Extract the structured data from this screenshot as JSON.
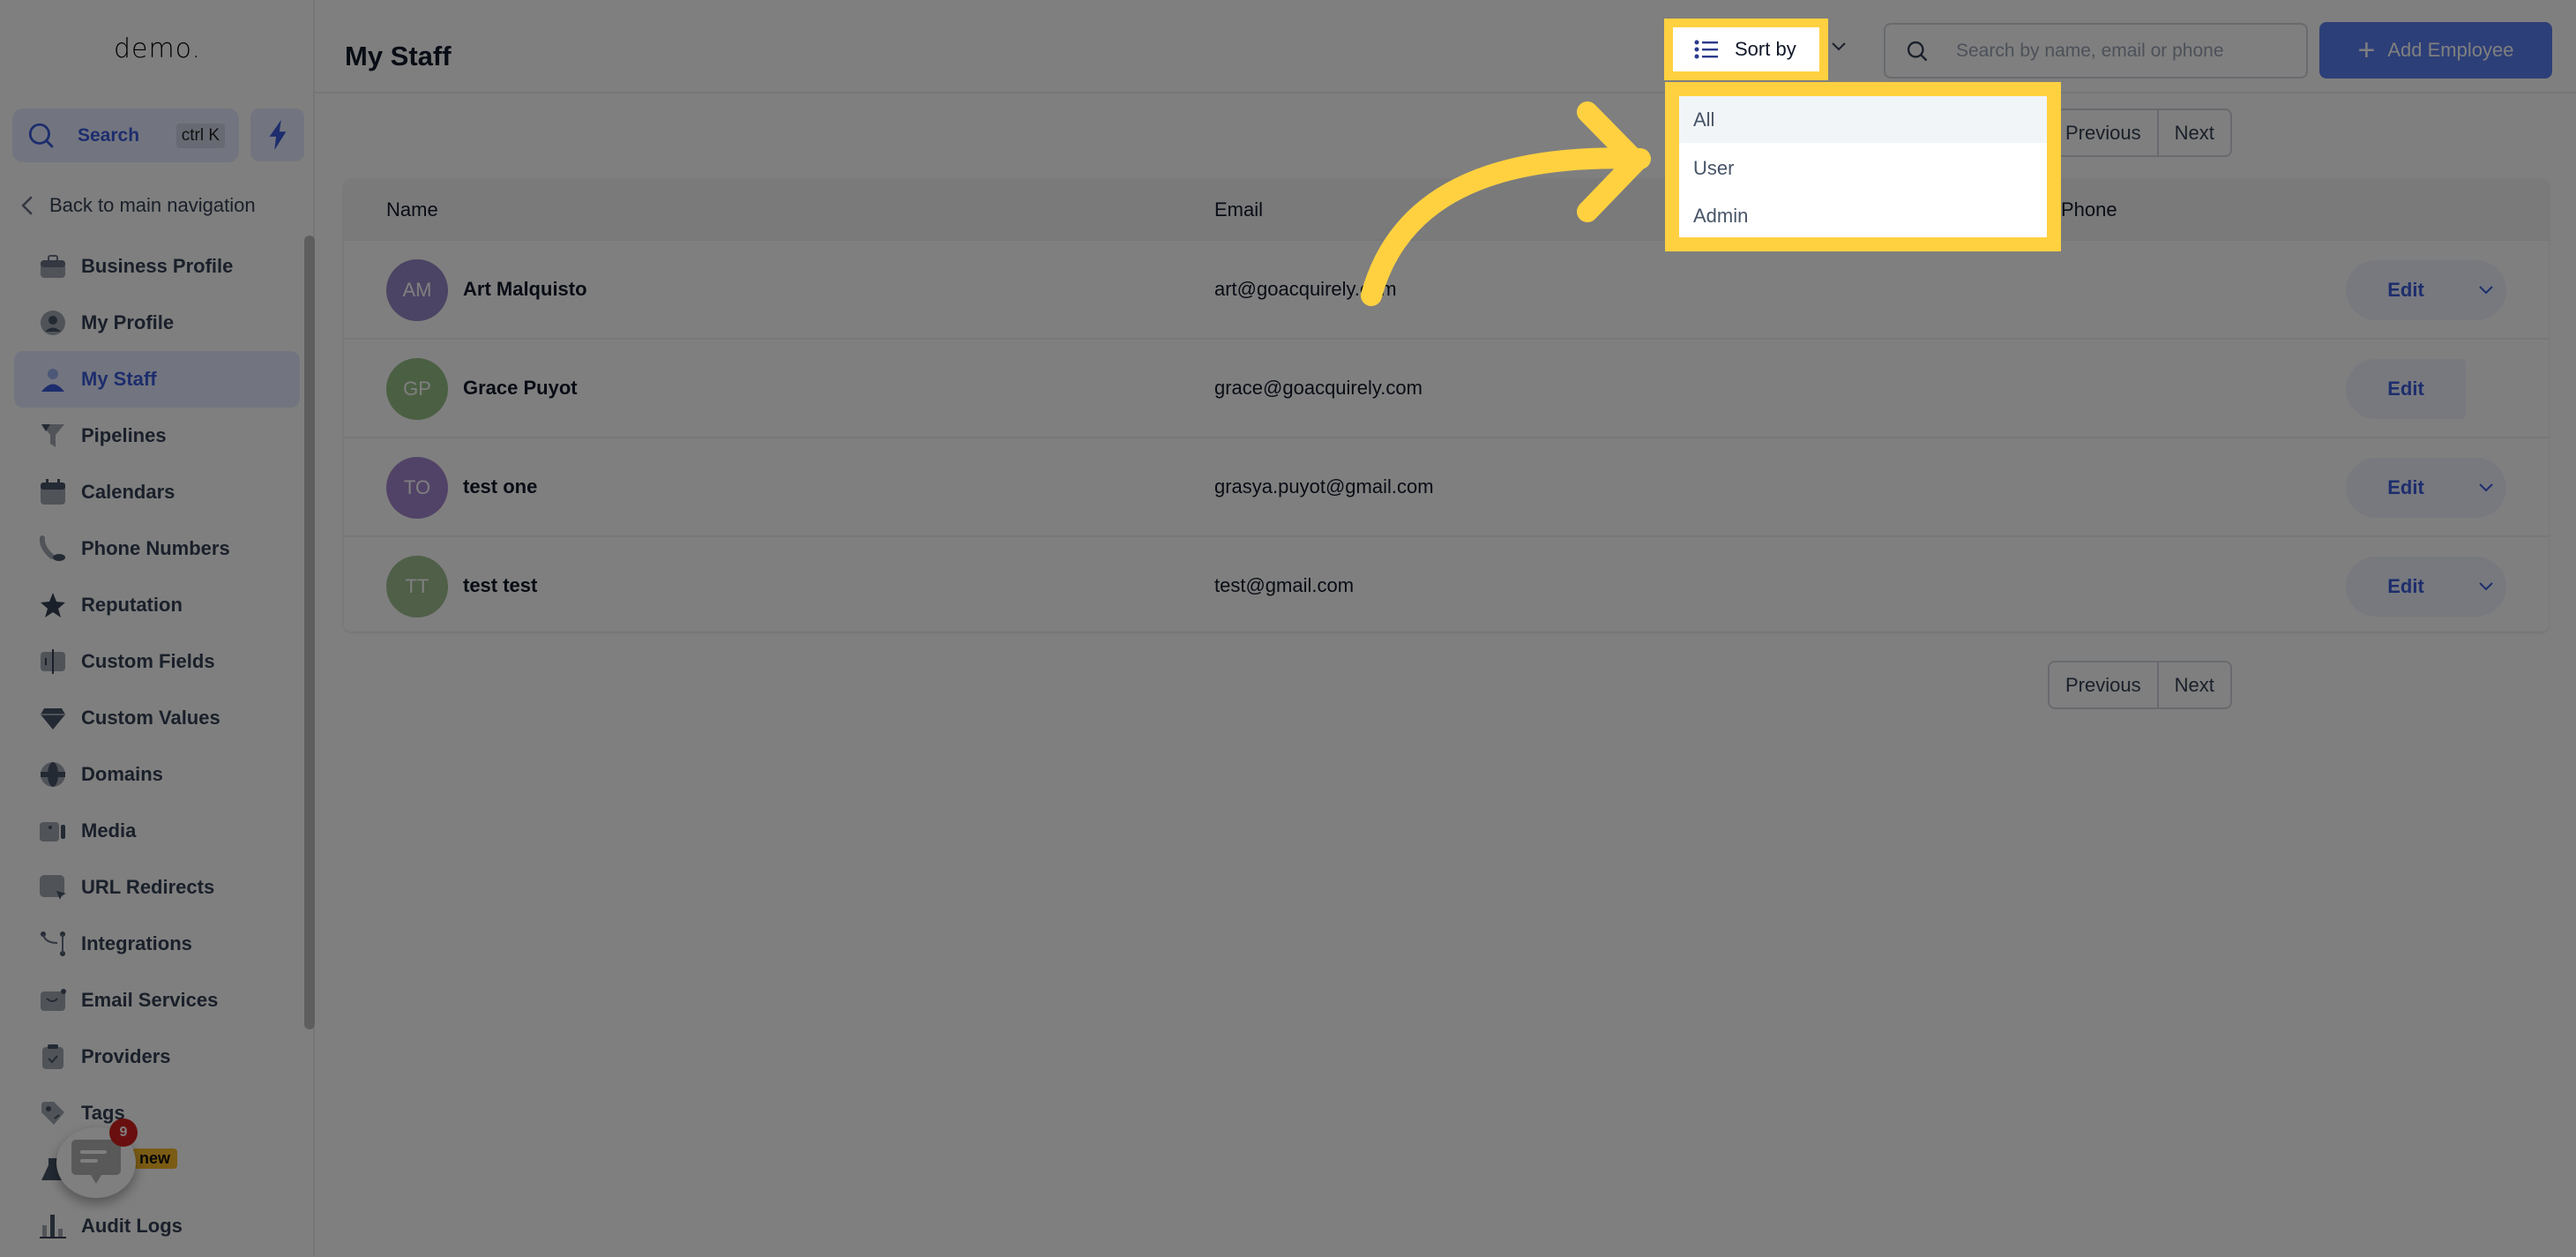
{
  "sidebar": {
    "logo": "demo.",
    "search": {
      "label": "Search",
      "shortcut": "ctrl K"
    },
    "back_label": "Back to main navigation",
    "items": [
      {
        "label": "Business Profile",
        "icon": "briefcase-icon",
        "active": false
      },
      {
        "label": "My Profile",
        "icon": "user-circle-icon",
        "active": false
      },
      {
        "label": "My Staff",
        "icon": "person-icon",
        "active": true
      },
      {
        "label": "Pipelines",
        "icon": "funnel-icon",
        "active": false
      },
      {
        "label": "Calendars",
        "icon": "calendar-icon",
        "active": false
      },
      {
        "label": "Phone Numbers",
        "icon": "phone-icon",
        "active": false
      },
      {
        "label": "Reputation",
        "icon": "star-icon",
        "active": false
      },
      {
        "label": "Custom Fields",
        "icon": "custom-fields-icon",
        "active": false
      },
      {
        "label": "Custom Values",
        "icon": "custom-values-icon",
        "active": false
      },
      {
        "label": "Domains",
        "icon": "globe-icon",
        "active": false
      },
      {
        "label": "Media",
        "icon": "video-icon",
        "active": false
      },
      {
        "label": "URL Redirects",
        "icon": "cursor-icon",
        "active": false
      },
      {
        "label": "Integrations",
        "icon": "branch-icon",
        "active": false
      },
      {
        "label": "Email Services",
        "icon": "mail-icon",
        "active": false
      },
      {
        "label": "Providers",
        "icon": "clipboard-check-icon",
        "active": false
      },
      {
        "label": "Tags",
        "icon": "tag-icon",
        "active": false
      },
      {
        "label": "",
        "icon": "flask-icon",
        "active": false,
        "badge": "new"
      },
      {
        "label": "Audit Logs",
        "icon": "bar-chart-icon",
        "active": false
      }
    ]
  },
  "chat_widget": {
    "unread_count": "9"
  },
  "header": {
    "title": "My Staff",
    "sort_label": "Sort by",
    "search_placeholder": "Search by name, email or phone",
    "add_button": "Add Employee"
  },
  "sort_dropdown": {
    "options": [
      "All",
      "User",
      "Admin"
    ],
    "highlighted": "All"
  },
  "pagination": {
    "previous": "Previous",
    "next": "Next"
  },
  "table": {
    "columns": [
      "Name",
      "Email",
      "Phone"
    ],
    "rows": [
      {
        "initials": "AM",
        "name": "Art Malquisto",
        "email": "art@goacquirely.com",
        "phone": "",
        "avatar_color": "#8e7cc3",
        "has_menu": true,
        "action": "Edit"
      },
      {
        "initials": "GP",
        "name": "Grace Puyot",
        "email": "grace@goacquirely.com",
        "phone": "",
        "avatar_color": "#8bba7a",
        "has_menu": false,
        "action": "Edit"
      },
      {
        "initials": "TO",
        "name": "test one",
        "email": "grasya.puyot@gmail.com",
        "phone": "",
        "avatar_color": "#9a7ac9",
        "has_menu": true,
        "action": "Edit"
      },
      {
        "initials": "TT",
        "name": "test test",
        "email": "test@gmail.com",
        "phone": "",
        "avatar_color": "#94b984",
        "has_menu": true,
        "action": "Edit"
      }
    ]
  },
  "colors": {
    "accent": "#3b5bdb",
    "highlight": "#ffd140",
    "add_button": "#5a7ff0"
  }
}
